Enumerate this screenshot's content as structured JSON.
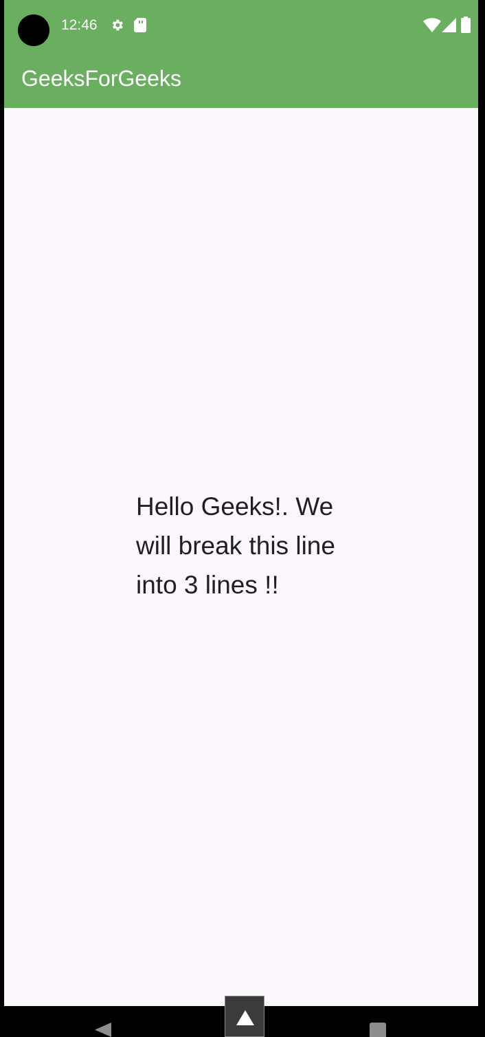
{
  "status_bar": {
    "time": "12:46",
    "icons": [
      "settings-icon",
      "sd-card-icon",
      "wifi-icon",
      "signal-icon",
      "battery-icon"
    ],
    "color": "#69af5f"
  },
  "app_bar": {
    "title": "GeeksForGeeks",
    "color": "#69af5f",
    "text_color": "#ffffff"
  },
  "main": {
    "message": "Hello Geeks!. We will break this line into 3 lines !!",
    "background": "#fbf7fd",
    "text_color": "#1f1f1f"
  },
  "navigation_bar": {
    "icons": [
      "back-icon",
      "home-icon",
      "recents-icon"
    ],
    "color": "#000000"
  },
  "floating_control": {
    "icon": "expand-up-icon"
  }
}
